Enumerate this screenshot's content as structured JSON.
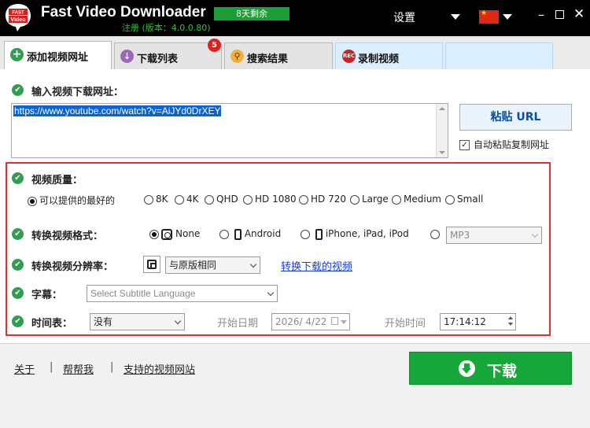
{
  "app": {
    "title": "Fast Video Downloader",
    "trial_badge": "8天剩余",
    "registration": "注册 (版本：4.0.0.80)",
    "logo_text": "FAST Video",
    "settings_label": "设置",
    "language_flag": "china-flag"
  },
  "tabs": [
    {
      "label": "添加视频网址",
      "icon": "plus-icon",
      "active": true
    },
    {
      "label": "下载列表",
      "icon": "download-icon",
      "badge": "5"
    },
    {
      "label": "搜索结果",
      "icon": "search-icon"
    },
    {
      "label": "录制视频",
      "icon": "rec-icon",
      "icon_text": "REC"
    }
  ],
  "url_section": {
    "label": "输入视频下载网址：",
    "url_value": "https://www.youtube.com/watch?v=AiJYd0DrXEY",
    "paste_button": "粘贴 URL",
    "auto_paste_label": "自动粘贴复制网址",
    "auto_paste_checked": true
  },
  "quality": {
    "label": "视频质量：",
    "options": [
      "可以提供的最好的",
      "8K",
      "4K",
      "QHD",
      "HD 1080",
      "HD 720",
      "Large",
      "Medium",
      "Small"
    ],
    "selected": "可以提供的最好的"
  },
  "format": {
    "label": "转换视频格式：",
    "options": [
      "None",
      "Android",
      "iPhone, iPad, iPod"
    ],
    "selected": "None",
    "audio_select": "MP3"
  },
  "resolution": {
    "label": "转换视频分辨率：",
    "value": "与原版相同",
    "link": "转换下载的视频"
  },
  "subtitle": {
    "label": "字幕：",
    "placeholder": "Select Subtitle Language"
  },
  "schedule": {
    "label": "时间表：",
    "value": "没有",
    "start_date_label": "开始日期",
    "start_date": "2026/ 4/22",
    "start_time_label": "开始时间",
    "start_time": "17:14:12"
  },
  "footer": {
    "about": "关于",
    "help": "帮帮我",
    "supported_sites": "支持的视频网站",
    "separator": "|",
    "download_button": "下载"
  },
  "colors": {
    "accent_green": "#17a63a",
    "highlight_red": "#e03030",
    "link_blue": "#1a3fd0"
  }
}
